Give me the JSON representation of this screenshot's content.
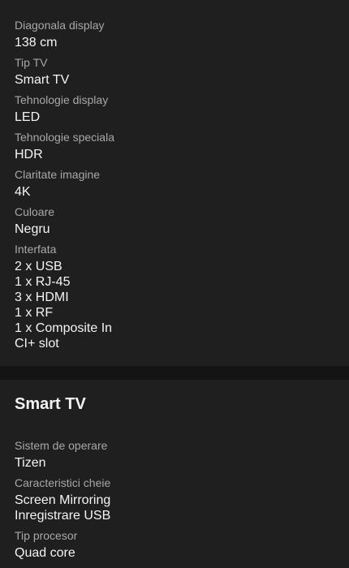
{
  "general": {
    "specs": [
      {
        "label": "Diagonala display",
        "value": "138 cm"
      },
      {
        "label": "Tip TV",
        "value": "Smart TV"
      },
      {
        "label": "Tehnologie display",
        "value": "LED"
      },
      {
        "label": "Tehnologie speciala",
        "value": "HDR"
      },
      {
        "label": "Claritate imagine",
        "value": "4K"
      },
      {
        "label": "Culoare",
        "value": "Negru"
      }
    ],
    "interface": {
      "label": "Interfata",
      "values": [
        "2 x USB",
        "1 x RJ-45",
        "3 x HDMI",
        "1 x RF",
        "1 x Composite In",
        "CI+ slot"
      ]
    }
  },
  "smart_tv": {
    "title": "Smart TV",
    "os": {
      "label": "Sistem de operare",
      "value": "Tizen"
    },
    "features": {
      "label": "Caracteristici cheie",
      "values": [
        "Screen Mirroring",
        "Inregistrare USB"
      ]
    },
    "processor": {
      "label": "Tip procesor",
      "value": "Quad core"
    }
  }
}
